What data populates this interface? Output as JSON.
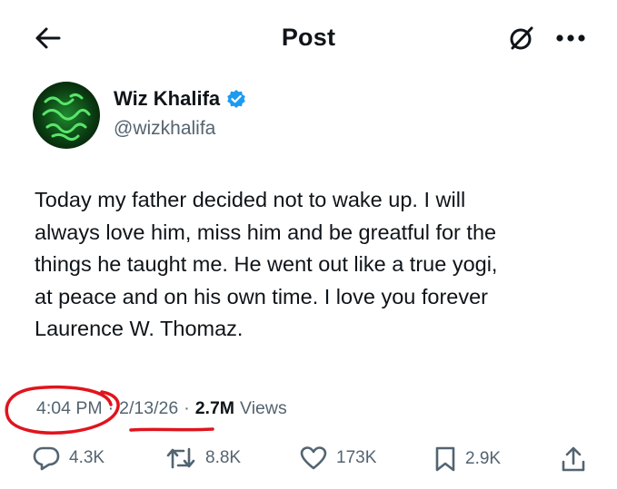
{
  "header": {
    "title": "Post",
    "back_icon": "arrow-left-icon",
    "grok_icon": "grok-icon",
    "more_icon": "more-horizontal-icon"
  },
  "author": {
    "display_name": "Wiz Khalifa",
    "handle": "@wizkhalifa",
    "verified": true,
    "verified_color": "#1d9bf0",
    "avatar_icon": "avatar-image"
  },
  "tweet": {
    "lines": [
      "Today my father decided not to wake up. I will",
      "always love him, miss him and be greatful for the",
      "things he taught me. He went out like a true yogi,",
      "at peace and on his own time. I love you forever",
      "Laurence W. Thomaz."
    ]
  },
  "meta": {
    "time": "4:04 PM",
    "separator": "·",
    "date": "2/13/26",
    "views_count": "2.7M",
    "views_label": "Views"
  },
  "actions": {
    "reply_count": "4.3K",
    "repost_count": "8.8K",
    "like_count": "173K",
    "bookmark_count": "2.9K"
  },
  "colors": {
    "text": "#0f1419",
    "muted": "#536471",
    "annotation": "#e0141e"
  }
}
